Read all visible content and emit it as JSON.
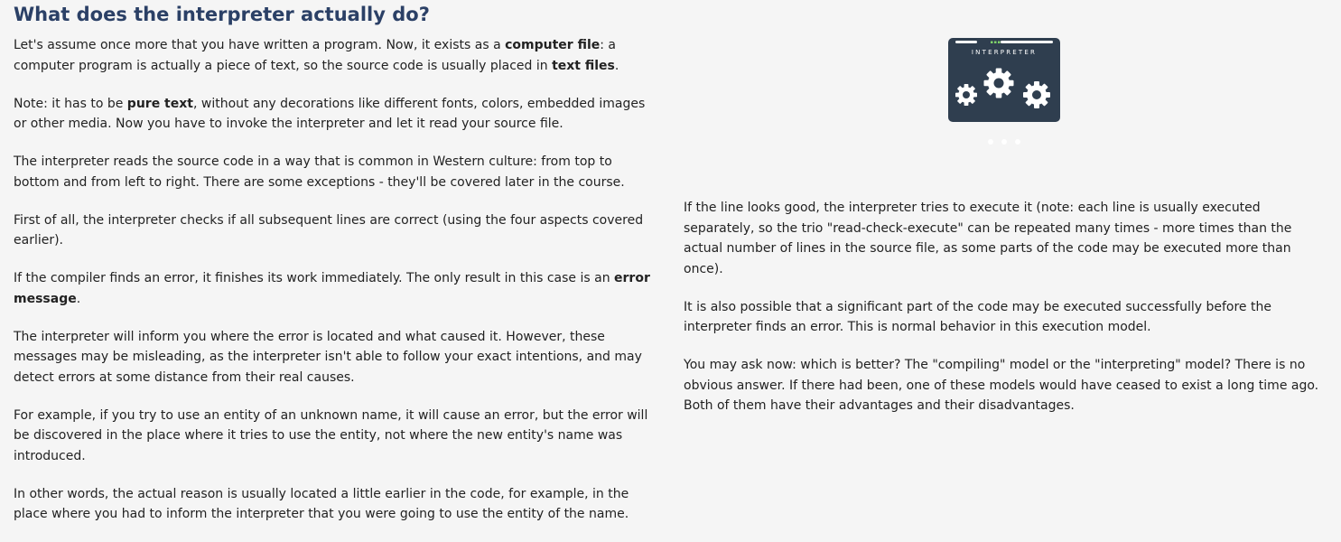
{
  "page": {
    "title": "What does the interpreter actually do?"
  },
  "left_column": {
    "p1": {
      "t1": "Let's assume once more that you have written a program. Now, it exists as a ",
      "b1": "computer file",
      "t2": ": a computer program is actually a piece of text, so the source code is usually placed in ",
      "b2": "text files",
      "t3": "."
    },
    "p2": {
      "t1": "Note: it has to be ",
      "b1": "pure text",
      "t2": ", without any decorations like different fonts, colors, embedded images or other media. Now you have to invoke the interpreter and let it read your source file."
    },
    "p3": "The interpreter reads the source code in a way that is common in Western culture: from top to bottom and from left to right. There are some exceptions - they'll be covered later in the course.",
    "p4": "First of all, the interpreter checks if all subsequent lines are correct (using the four aspects covered earlier).",
    "p5": {
      "t1": "If the compiler finds an error, it finishes its work immediately. The only result in this case is an ",
      "b1": "error message",
      "t2": "."
    },
    "p6": "The interpreter will inform you where the error is located and what caused it. However, these messages may be misleading, as the interpreter isn't able to follow your exact intentions, and may detect errors at some distance from their real causes.",
    "p7": "For example, if you try to use an entity of an unknown name, it will cause an error, but the error will be discovered in the place where it tries to use the entity, not where the new entity's name was introduced.",
    "p8": "In other words, the actual reason is usually located a little earlier in the code, for example, in the place where you had to inform the interpreter that you were going to use the entity of the name."
  },
  "illustration": {
    "label": "INTERPRETER",
    "icon": "interpreter-gears-icon",
    "colors": {
      "panel": "#2f3e4f",
      "gear": "#ffffff",
      "led": "#7fd36a",
      "dots": "#ffffff"
    }
  },
  "right_column": {
    "p1": "If the line looks good, the interpreter tries to execute it (note: each line is usually executed separately, so the trio \"read-check-execute\" can be repeated many times - more times than the actual number of lines in the source file, as some parts of the code may be executed more than once).",
    "p2": "It is also possible that a significant part of the code may be executed successfully before the interpreter finds an error. This is normal behavior in this execution model.",
    "p3": "You may ask now: which is better? The \"compiling\" model or the \"interpreting\" model? There is no obvious answer. If there had been, one of these models would have ceased to exist a long time ago. Both of them have their advantages and their disadvantages."
  }
}
